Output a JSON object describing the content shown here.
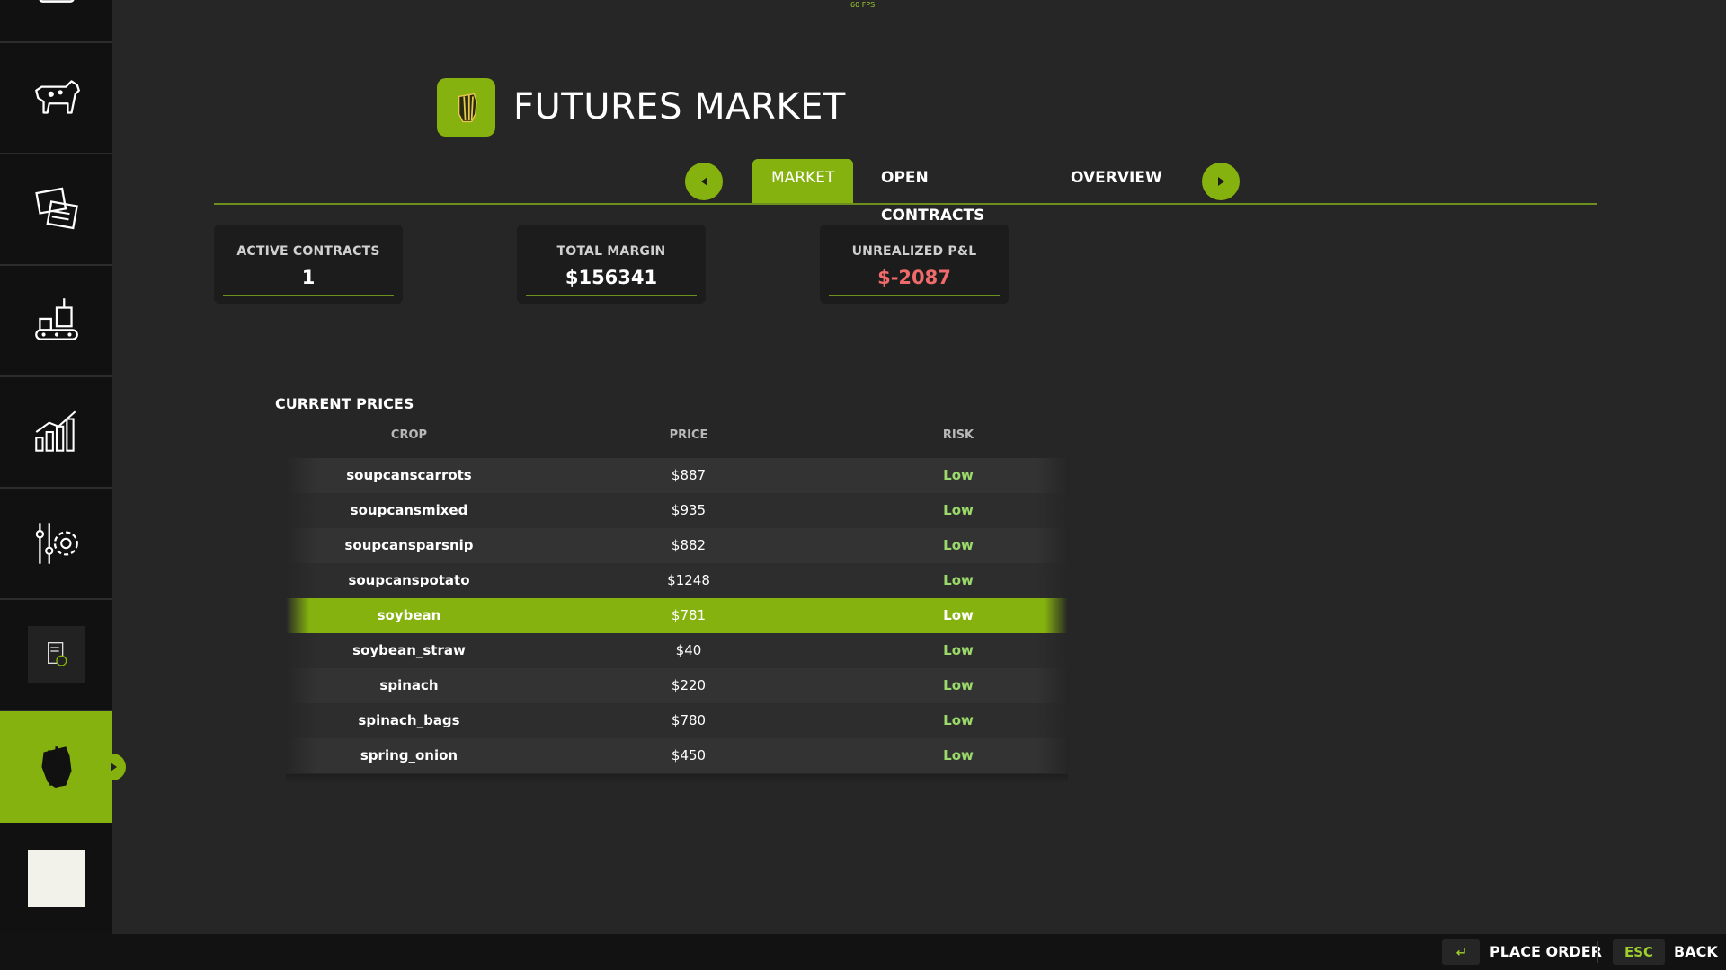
{
  "fps": "60 FPS",
  "header": {
    "title": "FUTURES MARKET",
    "icon": "crop-bundle-icon"
  },
  "tabs": [
    {
      "label": "MARKET",
      "active": true
    },
    {
      "label": "OPEN CONTRACTS",
      "active": false
    },
    {
      "label": "OVERVIEW",
      "active": false
    }
  ],
  "stats": {
    "active_contracts": {
      "label": "ACTIVE CONTRACTS",
      "value": "1"
    },
    "total_margin": {
      "label": "TOTAL MARGIN",
      "value": "$156341"
    },
    "unrealized_pl": {
      "label": "UNREALIZED P&L",
      "value": "$-2087"
    }
  },
  "prices": {
    "title": "CURRENT PRICES",
    "columns": [
      "CROP",
      "PRICE",
      "RISK"
    ],
    "rows": [
      {
        "crop": "soupcanscarrots",
        "price": "$887",
        "risk": "Low"
      },
      {
        "crop": "soupcansmixed",
        "price": "$935",
        "risk": "Low"
      },
      {
        "crop": "soupcansparsnip",
        "price": "$882",
        "risk": "Low"
      },
      {
        "crop": "soupcanspotato",
        "price": "$1248",
        "risk": "Low"
      },
      {
        "crop": "soybean",
        "price": "$781",
        "risk": "Low",
        "selected": true
      },
      {
        "crop": "soybean_straw",
        "price": "$40",
        "risk": "Low"
      },
      {
        "crop": "spinach",
        "price": "$220",
        "risk": "Low"
      },
      {
        "crop": "spinach_bags",
        "price": "$780",
        "risk": "Low"
      },
      {
        "crop": "spring_onion",
        "price": "$450",
        "risk": "Low"
      }
    ]
  },
  "sidebar": {
    "items": [
      "top-partial-icon",
      "cow-icon",
      "contracts-icon",
      "production-icon",
      "statistics-icon",
      "settings-icon",
      "ledger-icon",
      "futures-icon",
      "blank-tile"
    ],
    "active_index": 7
  },
  "footer": {
    "place_order": {
      "key_icon": "enter-key-icon",
      "label": "PLACE ORDER"
    },
    "back": {
      "key": "ESC",
      "label": "BACK"
    }
  },
  "colors": {
    "accent": "#86b20f",
    "negative": "#ef6a6a",
    "risk_low": "#9ad96a",
    "background": "#262626"
  }
}
